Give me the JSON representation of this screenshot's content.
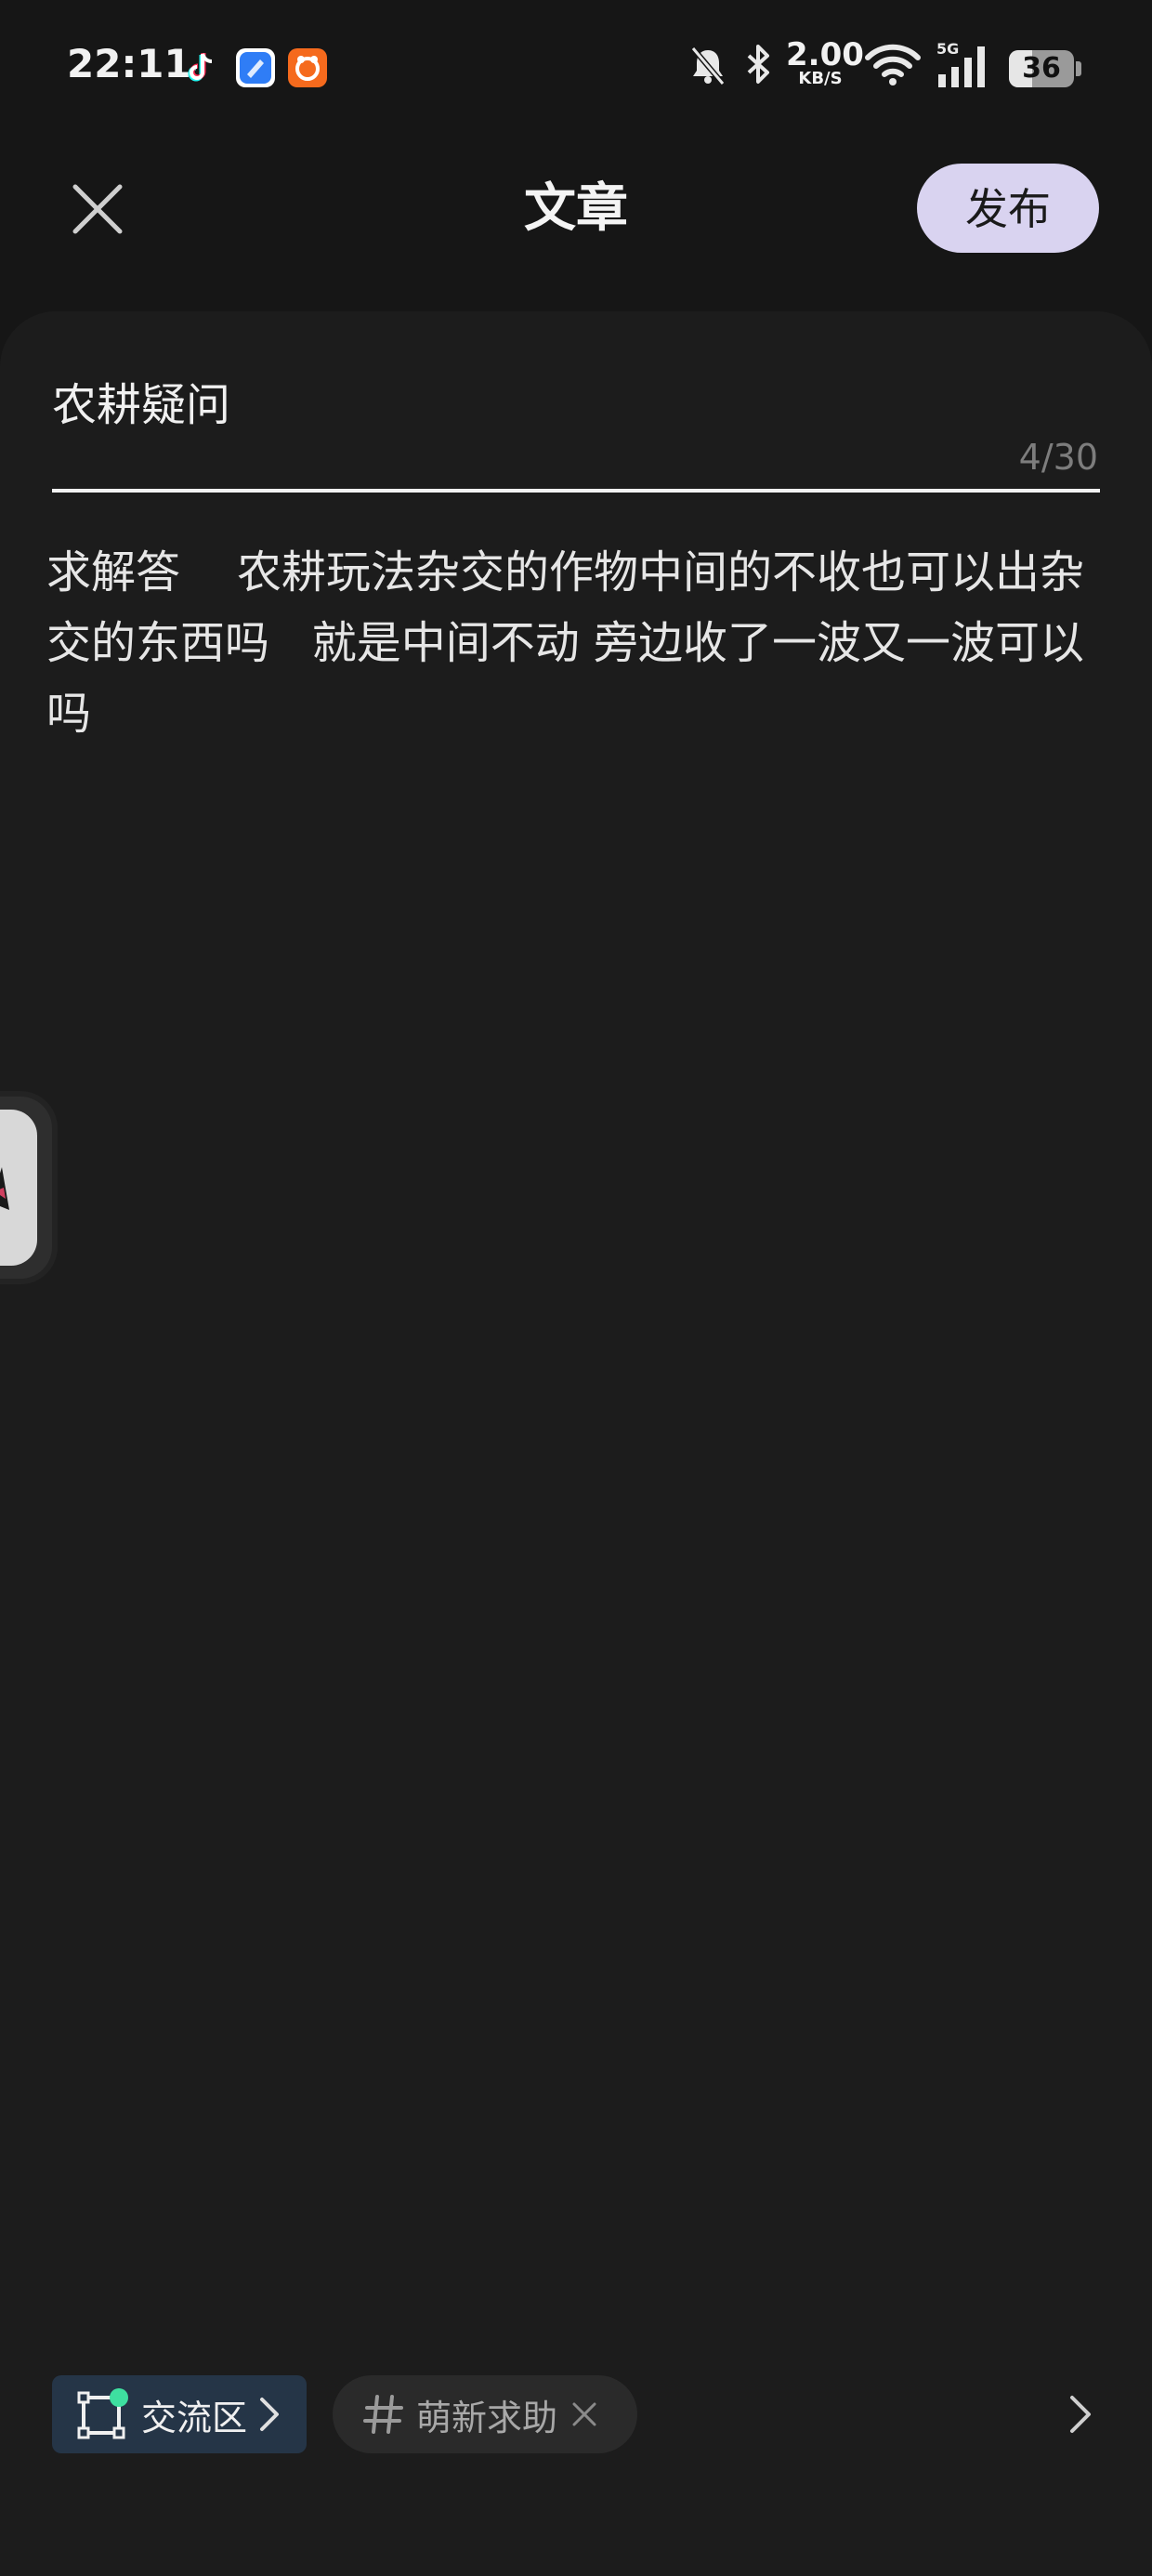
{
  "status_bar": {
    "time": "22:11",
    "apps": [
      "tiktok-icon",
      "blue-app-icon",
      "orange-app-icon"
    ],
    "network_speed_value": "2.00",
    "network_speed_unit": "KB/S",
    "network_type": "5G",
    "battery_level": "36",
    "battery_fraction": 0.36
  },
  "header": {
    "title": "文章",
    "publish_label": "发布"
  },
  "editor": {
    "title_value": "农耕疑问",
    "title_counter": "4/30",
    "body_text": "求解答    农耕玩法杂交的作物中间的不收也可以出杂交的东西吗   就是中间不动 旁边收了一波又一波可以吗"
  },
  "bottom_bar": {
    "section_label": "交流区",
    "tag_label": "萌新求助"
  },
  "colors": {
    "background": "#161616",
    "card": "#1c1c1c",
    "publish_button": "#d9d3f0",
    "section_chip": "#253547",
    "section_icon_accent": "#3ee0a0",
    "tag_chip": "#2a2a2a"
  }
}
